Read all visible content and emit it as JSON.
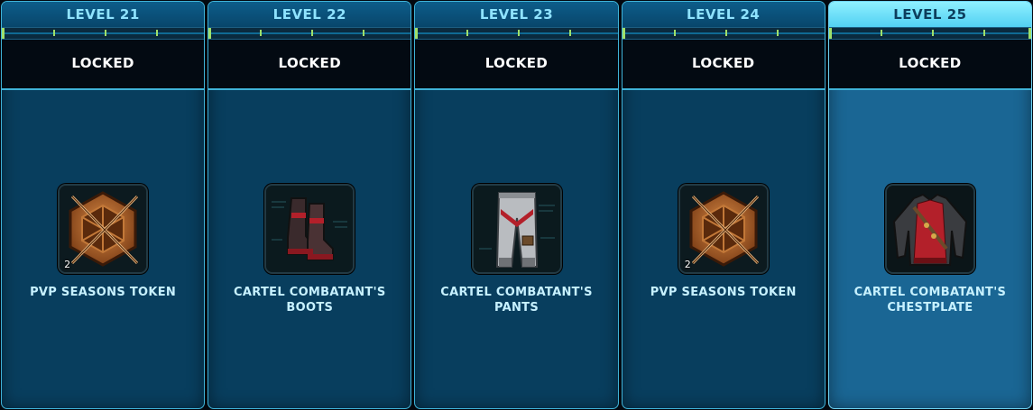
{
  "tiers": [
    {
      "level": "LEVEL 21",
      "status": "LOCKED",
      "reward_name": "PVP SEASONS TOKEN",
      "reward_icon": "pvp-token-icon",
      "quantity": "2"
    },
    {
      "level": "LEVEL 22",
      "status": "LOCKED",
      "reward_name": "CARTEL COMBATANT'S BOOTS",
      "reward_icon": "boots-icon",
      "quantity": ""
    },
    {
      "level": "LEVEL 23",
      "status": "LOCKED",
      "reward_name": "CARTEL COMBATANT'S PANTS",
      "reward_icon": "pants-icon",
      "quantity": ""
    },
    {
      "level": "LEVEL 24",
      "status": "LOCKED",
      "reward_name": "PVP SEASONS TOKEN",
      "reward_icon": "pvp-token-icon",
      "quantity": "2"
    },
    {
      "level": "LEVEL 25",
      "status": "LOCKED",
      "reward_name": "CARTEL COMBATANT'S CHESTPLATE",
      "reward_icon": "chestplate-icon",
      "quantity": "",
      "current": true
    }
  ],
  "colors": {
    "panel": "#083e5e",
    "panel_current": "#1a6694",
    "header_text": "#8fe3ff",
    "reward_text": "#c7f1ff",
    "progress_tick": "#9fe06a",
    "border": "#3fb3d8"
  }
}
